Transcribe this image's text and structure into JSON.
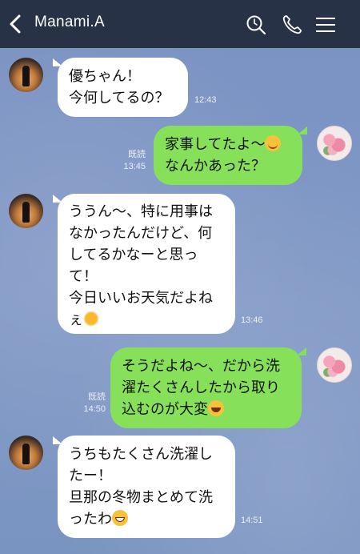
{
  "header": {
    "contact_name": "Manami.A",
    "back_icon": "back-arrow-icon",
    "search_icon": "search-icon",
    "phone_icon": "phone-icon",
    "menu_icon": "menu-icon"
  },
  "colors": {
    "header_bg": "#273246",
    "chat_bg": "#7b95c2",
    "incoming_bubble": "#ffffff",
    "outgoing_bubble": "#87e05a"
  },
  "messages": [
    {
      "direction": "incoming",
      "lines": [
        "優ちゃん！",
        "今何してるの？"
      ],
      "time": "12:43"
    },
    {
      "direction": "outgoing",
      "lines": [
        "家事してたよ〜",
        "なんかあった？"
      ],
      "emoji": "smiling-face-emoji",
      "read_label": "既読",
      "time": "13:45"
    },
    {
      "direction": "incoming",
      "lines": [
        "ううん〜、特に用事は",
        "なかったんだけど、何",
        "してるかなーと思っ",
        "て！",
        "今日いいお天気だよね",
        "ぇ"
      ],
      "emoji": "sun-emoji",
      "time": "13:46"
    },
    {
      "direction": "outgoing",
      "lines": [
        "そうだよね〜、だから洗",
        "濯たくさんしたから取り",
        "込むのが大変"
      ],
      "emoji": "laughing-tears-emoji",
      "read_label": "既読",
      "time": "14:50"
    },
    {
      "direction": "incoming",
      "lines": [
        "うちもたくさん洗濯し",
        "たー！",
        "旦那の冬物まとめて洗",
        "ったわ"
      ],
      "emoji": "grinning-emoji",
      "time": "14:51"
    }
  ]
}
